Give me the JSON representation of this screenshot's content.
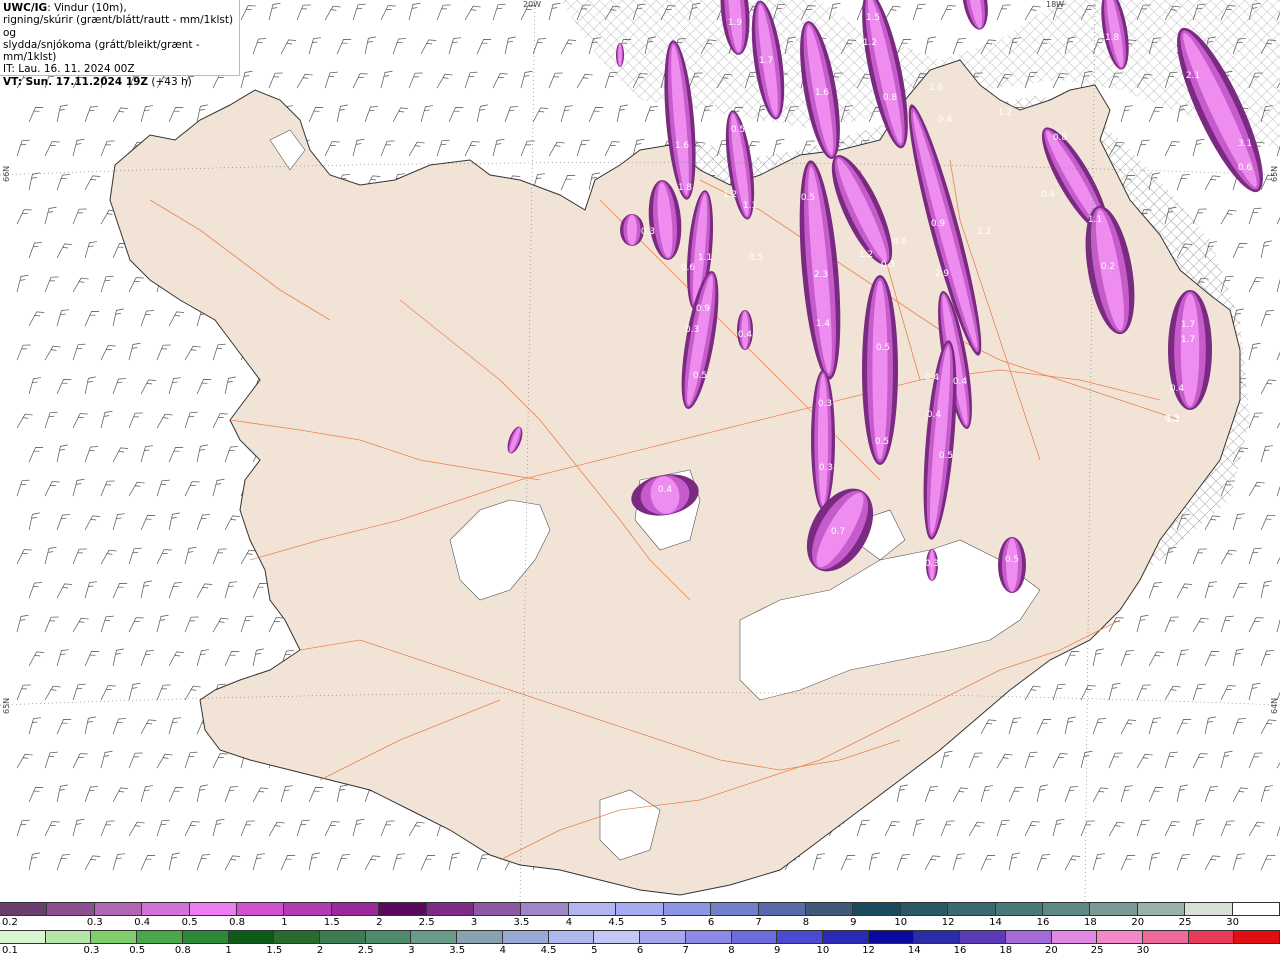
{
  "header": {
    "model": "UWC/IG",
    "line1_rest": ": Vindur (10m),",
    "line2": "rigning/skúrir (grænt/blátt/rautt - mm/1klst) og",
    "line3": "slydda/snjókoma (grátt/bleikt/grænt - mm/1klst)",
    "line4": "IT: Lau. 16. 11. 2024 00Z",
    "line5_bold": "VT: Sun. 17.11.2024 19Z",
    "line5_rest": " (+43 h)"
  },
  "map_edges": {
    "top_1": "20W",
    "top_2": "18W",
    "left_1": "66N",
    "left_2": "65N",
    "right_1": "65N",
    "right_2": "64N"
  },
  "precip_labels": [
    "1.9",
    "1.7",
    "1.2",
    "1.5",
    "1.5",
    "1.6",
    "0.8",
    "2.1",
    "3.1",
    "1.8",
    "1.6",
    "1.8",
    "0.5",
    "1.6",
    "0.8",
    "1.2",
    "1.1",
    "0.3",
    "0.5",
    "1.1",
    "0.6",
    "0.3",
    "0.9",
    "0.3",
    "0.5",
    "0.4",
    "2.3",
    "1.4",
    "1.2",
    "0.3",
    "0.5",
    "0.9",
    "2.9",
    "0.6",
    "0.4",
    "0.4",
    "0.4",
    "1.1",
    "0.2",
    "1.2",
    "1.7",
    "1.7",
    "0.4",
    "1.3",
    "0.6",
    "0.3",
    "0.5",
    "0.4",
    "0.5",
    "0.4",
    "0.7",
    "0.3",
    "0.5",
    "0.4",
    "0.5",
    "0.3",
    "1.2"
  ],
  "legend_snow": {
    "colors": [
      "#6b3c6e",
      "#8c4f8f",
      "#b066b3",
      "#d173d4",
      "#ec7cef",
      "#d050d0",
      "#b23cb4",
      "#9a2a9c",
      "#5a0a5c",
      "#7e2a86",
      "#8e58a8",
      "#9e86c8",
      "#b4b4ee",
      "#a6aaf0",
      "#8a96e4",
      "#7080cc",
      "#5a6aa8",
      "#3e5a78",
      "#1a4a60",
      "#2a5a66",
      "#3a6a70",
      "#4a7a78",
      "#5e8a86",
      "#7a9a96",
      "#9ab0aa",
      "#d8e0d8",
      "#ffffff"
    ],
    "labels": [
      "0.2",
      "0.3",
      "0.4",
      "0.5",
      "0.8",
      "1",
      "1.5",
      "2",
      "2.5",
      "3",
      "3.5",
      "4",
      "4.5",
      "5",
      "6",
      "7",
      "8",
      "9",
      "10",
      "12",
      "14",
      "16",
      "18",
      "20",
      "25",
      "30"
    ]
  },
  "legend_rain": {
    "colors": [
      "#d9f5d0",
      "#b6e6a6",
      "#7fcf6c",
      "#4aa84a",
      "#2a8a38",
      "#0e5a18",
      "#2a6a2e",
      "#3e7a52",
      "#4f8a6a",
      "#6b9a8a",
      "#8aa2b0",
      "#9aa8d6",
      "#b0b6ee",
      "#c4c6f6",
      "#a6a6f0",
      "#8c8ae6",
      "#6c6adc",
      "#4c4ad0",
      "#2a2ab8",
      "#0a0aa0",
      "#2c2ca8",
      "#5a3ab8",
      "#a46ad8",
      "#e08ae6",
      "#f28ac8",
      "#ee6a9a",
      "#e83a5a",
      "#e01010"
    ],
    "labels": [
      "0.1",
      "0.3",
      "0.5",
      "0.8",
      "1",
      "1.5",
      "2",
      "2.5",
      "3",
      "3.5",
      "4",
      "4.5",
      "5",
      "6",
      "7",
      "8",
      "9",
      "10",
      "12",
      "14",
      "16",
      "18",
      "20",
      "25",
      "30"
    ]
  },
  "colors": {
    "land": "#f1e4d6",
    "coast": "#333333",
    "roads": "#e8733a",
    "snow_light": "#ee8cf0",
    "snow_mid": "#c65ccc",
    "snow_dark": "#7a2a80",
    "hatch": "#8a8a8a"
  }
}
